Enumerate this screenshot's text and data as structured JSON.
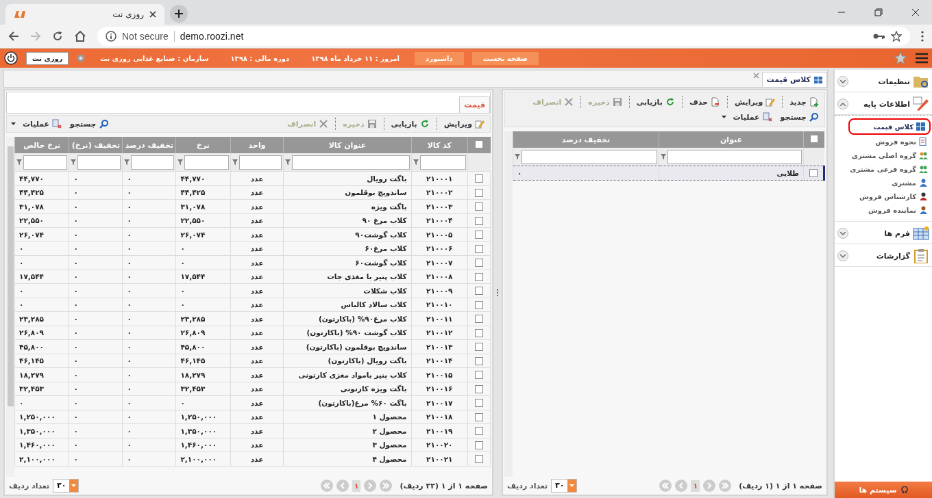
{
  "browser": {
    "tab_title": "روزی نت",
    "security": "Not secure",
    "url": "demo.roozi.net"
  },
  "header": {
    "buttons": [
      "صفحه نخست",
      "داشبورد"
    ],
    "info": [
      "امروز : ۱۱ خرداد ماه ۱۳۹۸",
      "دوره مالی : ۱۳۹۸",
      "سازمان : صنایع غذایی روزی نت"
    ],
    "company": "روزی نت"
  },
  "tabs": [
    {
      "label": "کلاس قیمت",
      "selected": true
    }
  ],
  "class_panel": {
    "toolbar": [
      {
        "label": "جدید",
        "kind": "new",
        "disabled": false
      },
      {
        "label": "ویرایش",
        "kind": "edit",
        "disabled": false
      },
      {
        "label": "حذف",
        "kind": "delete",
        "disabled": false
      },
      {
        "label": "بازیابی",
        "kind": "refresh",
        "disabled": false
      },
      {
        "label": "ذخیره",
        "kind": "save",
        "disabled": true
      },
      {
        "label": "انصراف",
        "kind": "cancel",
        "disabled": true
      }
    ],
    "toolbar2": [
      {
        "label": "جستجو",
        "kind": "search",
        "disabled": false
      },
      {
        "label": "عملیات",
        "kind": "ops",
        "disabled": false
      }
    ],
    "columns": [
      "عنوان",
      "تخفیف درصد"
    ],
    "select_all_checked": false,
    "rows": [
      {
        "cells": [
          "طلایی",
          "۰"
        ],
        "selected": true,
        "checked": false
      }
    ],
    "pager": {
      "summary": "صفحه ۱ از ۱ (۱ ردیف)",
      "page": "۱",
      "page_size": "۳۰",
      "page_size_label": "تعداد ردیف"
    }
  },
  "price_panel": {
    "tabs": [
      {
        "label": "قیمت",
        "selected": true
      }
    ],
    "toolbar": [
      {
        "label": "ویرایش",
        "kind": "edit",
        "disabled": false
      },
      {
        "label": "بازیابی",
        "kind": "refresh",
        "disabled": false
      },
      {
        "label": "ذخیره",
        "kind": "save",
        "disabled": true
      },
      {
        "label": "انصراف",
        "kind": "cancel",
        "disabled": true
      }
    ],
    "toolbar2": [
      {
        "label": "جستجو",
        "kind": "search",
        "disabled": false
      },
      {
        "label": "عملیات",
        "kind": "ops",
        "disabled": false
      }
    ],
    "columns": [
      "کد کالا",
      "عنوان کالا",
      "واحد",
      "نرخ",
      "تخفیف درصد",
      "تخفیف (نرخ)",
      "نرخ خالص"
    ],
    "select_all_checked": false,
    "rows": [
      {
        "cells": [
          "۲۱۰۰۰۱",
          "باگت رویال",
          "عدد",
          "۴۴,۷۷۰",
          "۰",
          "۰",
          "۴۴,۷۷۰"
        ],
        "checked": false
      },
      {
        "cells": [
          "۲۱۰۰۰۲",
          "ساندویچ بوقلمون",
          "عدد",
          "۴۴,۴۲۵",
          "۰",
          "۰",
          "۴۴,۴۲۵"
        ],
        "checked": false
      },
      {
        "cells": [
          "۲۱۰۰۰۳",
          "باگت ویژه",
          "عدد",
          "۳۱,۰۷۸",
          "۰",
          "۰",
          "۳۱,۰۷۸"
        ],
        "checked": false
      },
      {
        "cells": [
          "۲۱۰۰۰۴",
          "کلاب مرغ ۹۰",
          "عدد",
          "۲۲,۵۵۰",
          "۰",
          "۰",
          "۲۲,۵۵۰"
        ],
        "checked": false
      },
      {
        "cells": [
          "۲۱۰۰۰۵",
          "کلاب گوشت۹۰",
          "عدد",
          "۲۶,۰۷۴",
          "۰",
          "۰",
          "۲۶,۰۷۴"
        ],
        "checked": false
      },
      {
        "cells": [
          "۲۱۰۰۰۶",
          "کلاب مرغ۶۰",
          "عدد",
          "۰",
          "۰",
          "۰",
          "۰"
        ],
        "checked": false
      },
      {
        "cells": [
          "۲۱۰۰۰۷",
          "کلاب گوشت۶۰",
          "عدد",
          "۰",
          "۰",
          "۰",
          "۰"
        ],
        "checked": false
      },
      {
        "cells": [
          "۲۱۰۰۰۸",
          "کلاب پنیر با مغذی جات",
          "عدد",
          "۱۷,۵۴۴",
          "۰",
          "۰",
          "۱۷,۵۴۴"
        ],
        "checked": false
      },
      {
        "cells": [
          "۲۱۰۰۰۹",
          "کلاب شکلات",
          "عدد",
          "۰",
          "۰",
          "۰",
          "۰"
        ],
        "checked": false
      },
      {
        "cells": [
          "۲۱۰۰۱۰",
          "کلاب سالاد کالباس",
          "عدد",
          "۰",
          "۰",
          "۰",
          "۰"
        ],
        "checked": false
      },
      {
        "cells": [
          "۲۱۰۰۱۱",
          "کلاب مرغ۹۰% (باکارتون)",
          "عدد",
          "۲۳,۲۸۵",
          "۰",
          "۰",
          "۲۳,۲۸۵"
        ],
        "checked": false
      },
      {
        "cells": [
          "۲۱۰۰۱۲",
          "کلاب گوشت ۹۰% (باکارتون)",
          "عدد",
          "۲۶,۸۰۹",
          "۰",
          "۰",
          "۲۶,۸۰۹"
        ],
        "checked": false
      },
      {
        "cells": [
          "۲۱۰۰۱۳",
          "ساندویچ بوقلمون (باکارتون)",
          "عدد",
          "۴۵,۸۰۰",
          "۰",
          "۰",
          "۴۵,۸۰۰"
        ],
        "checked": false
      },
      {
        "cells": [
          "۲۱۰۰۱۴",
          "باگت رویال (باکارتون)",
          "عدد",
          "۴۶,۱۴۵",
          "۰",
          "۰",
          "۴۶,۱۴۵"
        ],
        "checked": false
      },
      {
        "cells": [
          "۲۱۰۰۱۵",
          "کلاب پنیر بامواد مغزی کارتونی",
          "عدد",
          "۱۸,۲۷۹",
          "۰",
          "۰",
          "۱۸,۲۷۹"
        ],
        "checked": false
      },
      {
        "cells": [
          "۲۱۰۰۱۶",
          "باگت ویژه کارتونی",
          "عدد",
          "۳۲,۴۵۳",
          "۰",
          "۰",
          "۳۲,۴۵۳"
        ],
        "checked": false
      },
      {
        "cells": [
          "۲۱۰۰۱۷",
          "باگت ۶۰% مرغ(باکارتون)",
          "عدد",
          "۰",
          "۰",
          "۰",
          "۰"
        ],
        "checked": false
      },
      {
        "cells": [
          "۲۱۰۰۱۸",
          "محصول ۱",
          "عدد",
          "۱,۲۵۰,۰۰۰",
          "۰",
          "۰",
          "۱,۲۵۰,۰۰۰"
        ],
        "checked": false
      },
      {
        "cells": [
          "۲۱۰۰۱۹",
          "محصول ۲",
          "عدد",
          "۱,۳۵۰,۰۰۰",
          "۰",
          "۰",
          "۱,۳۵۰,۰۰۰"
        ],
        "checked": false
      },
      {
        "cells": [
          "۲۱۰۰۲۰",
          "محصول ۳",
          "عدد",
          "۱,۴۶۰,۰۰۰",
          "۰",
          "۰",
          "۱,۴۶۰,۰۰۰"
        ],
        "checked": false
      },
      {
        "cells": [
          "۲۱۰۰۲۱",
          "محصول ۴",
          "عدد",
          "۲,۱۰۰,۰۰۰",
          "۰",
          "۰",
          "۲,۱۰۰,۰۰۰"
        ],
        "checked": false
      }
    ],
    "pager": {
      "summary": "صفحه ۱ از ۱ (۲۲ ردیف)",
      "page": "۱",
      "page_size": "۳۰",
      "page_size_label": "تعداد ردیف"
    }
  },
  "sidebar": {
    "groups": [
      {
        "label": "تنظیمات",
        "kind": "settings",
        "expanded": false
      },
      {
        "label": "اطلاعات پایه",
        "kind": "base",
        "expanded": true,
        "items": [
          {
            "label": "کلاس قیمت",
            "kind": "grid",
            "selected": true
          },
          {
            "label": "نحوه فروش",
            "kind": "doc",
            "selected": false
          },
          {
            "label": "گروه اصلی مشتری",
            "kind": "group",
            "selected": false
          },
          {
            "label": "گروه فرعی مشتری",
            "kind": "subgroup",
            "selected": false
          },
          {
            "label": "مشتری",
            "kind": "person",
            "selected": false
          },
          {
            "label": "کارشناس فروش",
            "kind": "expert",
            "selected": false
          },
          {
            "label": "نماینده فروش",
            "kind": "agent",
            "selected": false
          }
        ]
      },
      {
        "label": "فرم ها",
        "kind": "forms",
        "expanded": false
      },
      {
        "label": "گزارشات",
        "kind": "reports",
        "expanded": false
      }
    ],
    "footer": "سیستم ها"
  }
}
